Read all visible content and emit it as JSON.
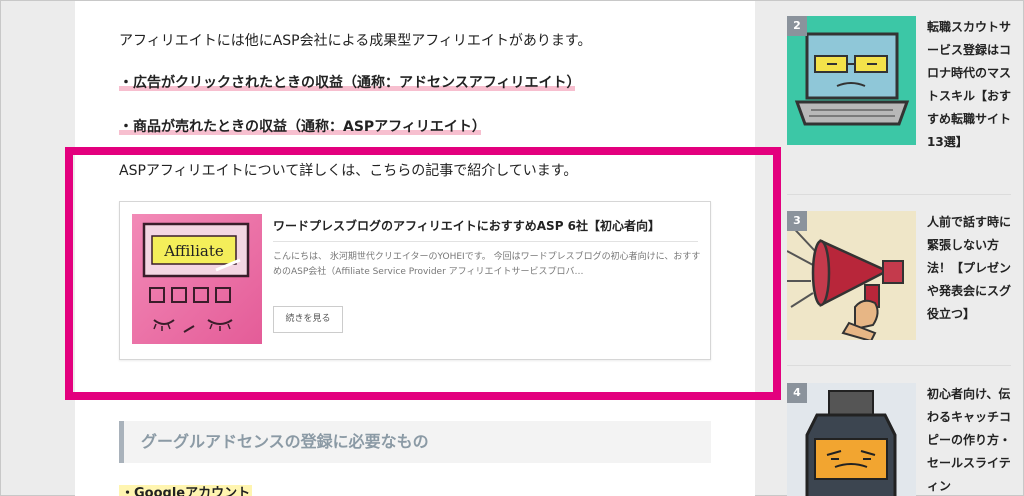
{
  "article": {
    "intro_line": "アフィリエイトには他にASP会社による成果型アフィリエイトがあります。",
    "bullet_1": "・広告がクリックされたときの収益（通称：アドセンスアフィリエイト）",
    "bullet_2": "・商品が売れたときの収益（通称：ASPアフィリエイト）",
    "detail_line": "ASPアフィリエイトについて詳しくは、こちらの記事で紹介しています。",
    "heading": "グーグルアドセンスの登録に必要なもの",
    "list_item_1": "・Googleアカウント"
  },
  "card": {
    "title": "ワードプレスブログのアフィリエイトにおすすめASP 6社【初心者向】",
    "excerpt": "こんにちは、 氷河期世代クリエイターのYOHEIです。 今回はワードプレスブログの初心者向けに、おすすめのASP会社（Affiliate Service Provider アフィリエイトサービスプロバ…",
    "button": "続きを見る",
    "thumb_text": "Affiliate"
  },
  "sidebar": {
    "items": [
      {
        "rank": "2",
        "title": "転職スカウトサービス登録はコロナ時代のマストスキル【おすすめ転職サイト13選】"
      },
      {
        "rank": "3",
        "title": "人前で話す時に緊張しない方法！【プレゼンや発表会にスグ役立つ】"
      },
      {
        "rank": "4",
        "title": "初心者向け、伝わるキャッチコピーの作り方・セールスライティン"
      }
    ]
  },
  "colors": {
    "highlight_border": "#e3007e",
    "underline_marker": "#f7bfcf",
    "yellow_marker": "#fff5b0",
    "rank_badge": "#8b939c"
  }
}
